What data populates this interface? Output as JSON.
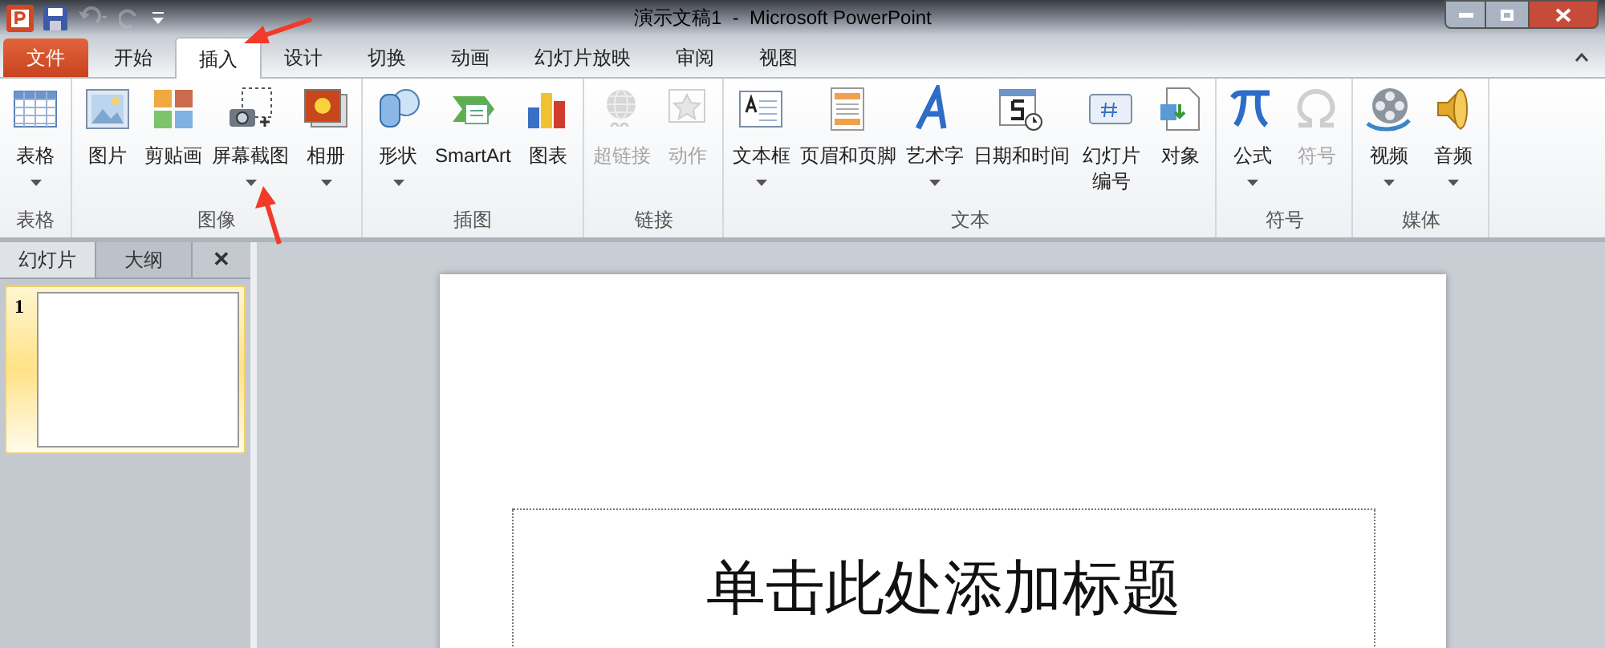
{
  "window": {
    "title": "演示文稿1  -  Microsoft PowerPoint"
  },
  "tabs": [
    {
      "label": "文件",
      "kind": "file",
      "selected": false
    },
    {
      "label": "开始",
      "kind": "tab",
      "selected": false
    },
    {
      "label": "插入",
      "kind": "tab",
      "selected": true
    },
    {
      "label": "设计",
      "kind": "tab",
      "selected": false
    },
    {
      "label": "切换",
      "kind": "tab",
      "selected": false
    },
    {
      "label": "动画",
      "kind": "tab",
      "selected": false
    },
    {
      "label": "幻灯片放映",
      "kind": "tab",
      "selected": false
    },
    {
      "label": "审阅",
      "kind": "tab",
      "selected": false
    },
    {
      "label": "视图",
      "kind": "tab",
      "selected": false
    }
  ],
  "ribbon_groups": [
    {
      "label": "表格",
      "buttons": [
        {
          "label": "表格",
          "dropdown": true,
          "disabled": false
        }
      ]
    },
    {
      "label": "图像",
      "buttons": [
        {
          "label": "图片",
          "dropdown": false,
          "disabled": false
        },
        {
          "label": "剪贴画",
          "dropdown": false,
          "disabled": false
        },
        {
          "label": "屏幕截图",
          "dropdown": true,
          "disabled": false
        },
        {
          "label": "相册",
          "dropdown": true,
          "disabled": false
        }
      ]
    },
    {
      "label": "插图",
      "buttons": [
        {
          "label": "形状",
          "dropdown": true,
          "disabled": false
        },
        {
          "label": "SmartArt",
          "dropdown": false,
          "disabled": false
        },
        {
          "label": "图表",
          "dropdown": false,
          "disabled": false
        }
      ]
    },
    {
      "label": "链接",
      "buttons": [
        {
          "label": "超链接",
          "dropdown": false,
          "disabled": true
        },
        {
          "label": "动作",
          "dropdown": false,
          "disabled": true
        }
      ]
    },
    {
      "label": "文本",
      "buttons": [
        {
          "label": "文本框",
          "dropdown": true,
          "disabled": false
        },
        {
          "label": "页眉和页脚",
          "dropdown": false,
          "disabled": false
        },
        {
          "label": "艺术字",
          "dropdown": true,
          "disabled": false
        },
        {
          "label": "日期和时间",
          "dropdown": false,
          "disabled": false
        },
        {
          "label": "幻灯片编号",
          "dropdown": false,
          "disabled": false,
          "wrapped": true
        },
        {
          "label": "对象",
          "dropdown": false,
          "disabled": false
        }
      ]
    },
    {
      "label": "符号",
      "buttons": [
        {
          "label": "公式",
          "dropdown": true,
          "disabled": false
        },
        {
          "label": "符号",
          "dropdown": false,
          "disabled": true
        }
      ]
    },
    {
      "label": "媒体",
      "buttons": [
        {
          "label": "视频",
          "dropdown": true,
          "disabled": false
        },
        {
          "label": "音频",
          "dropdown": true,
          "disabled": false
        }
      ]
    }
  ],
  "slide_pane": {
    "tabs": [
      {
        "label": "幻灯片",
        "selected": true
      },
      {
        "label": "大纲",
        "selected": false
      }
    ],
    "close": "✕",
    "slides": [
      {
        "number": "1",
        "selected": true
      }
    ]
  },
  "slide": {
    "title_placeholder": "单击此处添加标题"
  }
}
